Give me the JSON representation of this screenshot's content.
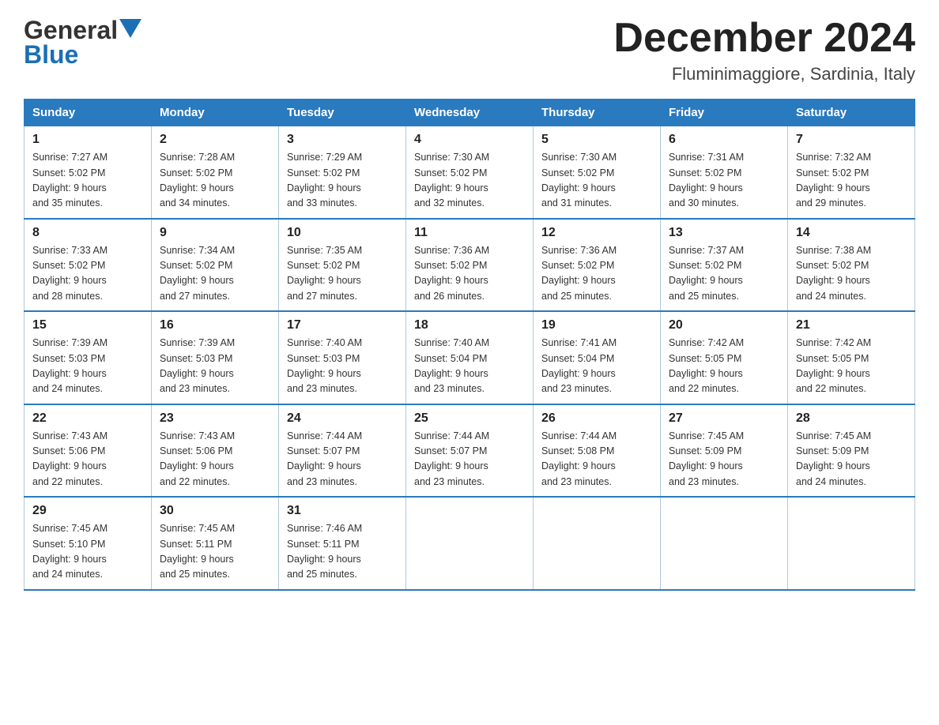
{
  "header": {
    "logo_part1": "General",
    "logo_part2": "Blue",
    "month_title": "December 2024",
    "location": "Fluminimaggiore, Sardinia, Italy"
  },
  "weekdays": [
    "Sunday",
    "Monday",
    "Tuesday",
    "Wednesday",
    "Thursday",
    "Friday",
    "Saturday"
  ],
  "weeks": [
    [
      {
        "day": "1",
        "sunrise": "7:27 AM",
        "sunset": "5:02 PM",
        "daylight": "9 hours and 35 minutes."
      },
      {
        "day": "2",
        "sunrise": "7:28 AM",
        "sunset": "5:02 PM",
        "daylight": "9 hours and 34 minutes."
      },
      {
        "day": "3",
        "sunrise": "7:29 AM",
        "sunset": "5:02 PM",
        "daylight": "9 hours and 33 minutes."
      },
      {
        "day": "4",
        "sunrise": "7:30 AM",
        "sunset": "5:02 PM",
        "daylight": "9 hours and 32 minutes."
      },
      {
        "day": "5",
        "sunrise": "7:30 AM",
        "sunset": "5:02 PM",
        "daylight": "9 hours and 31 minutes."
      },
      {
        "day": "6",
        "sunrise": "7:31 AM",
        "sunset": "5:02 PM",
        "daylight": "9 hours and 30 minutes."
      },
      {
        "day": "7",
        "sunrise": "7:32 AM",
        "sunset": "5:02 PM",
        "daylight": "9 hours and 29 minutes."
      }
    ],
    [
      {
        "day": "8",
        "sunrise": "7:33 AM",
        "sunset": "5:02 PM",
        "daylight": "9 hours and 28 minutes."
      },
      {
        "day": "9",
        "sunrise": "7:34 AM",
        "sunset": "5:02 PM",
        "daylight": "9 hours and 27 minutes."
      },
      {
        "day": "10",
        "sunrise": "7:35 AM",
        "sunset": "5:02 PM",
        "daylight": "9 hours and 27 minutes."
      },
      {
        "day": "11",
        "sunrise": "7:36 AM",
        "sunset": "5:02 PM",
        "daylight": "9 hours and 26 minutes."
      },
      {
        "day": "12",
        "sunrise": "7:36 AM",
        "sunset": "5:02 PM",
        "daylight": "9 hours and 25 minutes."
      },
      {
        "day": "13",
        "sunrise": "7:37 AM",
        "sunset": "5:02 PM",
        "daylight": "9 hours and 25 minutes."
      },
      {
        "day": "14",
        "sunrise": "7:38 AM",
        "sunset": "5:02 PM",
        "daylight": "9 hours and 24 minutes."
      }
    ],
    [
      {
        "day": "15",
        "sunrise": "7:39 AM",
        "sunset": "5:03 PM",
        "daylight": "9 hours and 24 minutes."
      },
      {
        "day": "16",
        "sunrise": "7:39 AM",
        "sunset": "5:03 PM",
        "daylight": "9 hours and 23 minutes."
      },
      {
        "day": "17",
        "sunrise": "7:40 AM",
        "sunset": "5:03 PM",
        "daylight": "9 hours and 23 minutes."
      },
      {
        "day": "18",
        "sunrise": "7:40 AM",
        "sunset": "5:04 PM",
        "daylight": "9 hours and 23 minutes."
      },
      {
        "day": "19",
        "sunrise": "7:41 AM",
        "sunset": "5:04 PM",
        "daylight": "9 hours and 23 minutes."
      },
      {
        "day": "20",
        "sunrise": "7:42 AM",
        "sunset": "5:05 PM",
        "daylight": "9 hours and 22 minutes."
      },
      {
        "day": "21",
        "sunrise": "7:42 AM",
        "sunset": "5:05 PM",
        "daylight": "9 hours and 22 minutes."
      }
    ],
    [
      {
        "day": "22",
        "sunrise": "7:43 AM",
        "sunset": "5:06 PM",
        "daylight": "9 hours and 22 minutes."
      },
      {
        "day": "23",
        "sunrise": "7:43 AM",
        "sunset": "5:06 PM",
        "daylight": "9 hours and 22 minutes."
      },
      {
        "day": "24",
        "sunrise": "7:44 AM",
        "sunset": "5:07 PM",
        "daylight": "9 hours and 23 minutes."
      },
      {
        "day": "25",
        "sunrise": "7:44 AM",
        "sunset": "5:07 PM",
        "daylight": "9 hours and 23 minutes."
      },
      {
        "day": "26",
        "sunrise": "7:44 AM",
        "sunset": "5:08 PM",
        "daylight": "9 hours and 23 minutes."
      },
      {
        "day": "27",
        "sunrise": "7:45 AM",
        "sunset": "5:09 PM",
        "daylight": "9 hours and 23 minutes."
      },
      {
        "day": "28",
        "sunrise": "7:45 AM",
        "sunset": "5:09 PM",
        "daylight": "9 hours and 24 minutes."
      }
    ],
    [
      {
        "day": "29",
        "sunrise": "7:45 AM",
        "sunset": "5:10 PM",
        "daylight": "9 hours and 24 minutes."
      },
      {
        "day": "30",
        "sunrise": "7:45 AM",
        "sunset": "5:11 PM",
        "daylight": "9 hours and 25 minutes."
      },
      {
        "day": "31",
        "sunrise": "7:46 AM",
        "sunset": "5:11 PM",
        "daylight": "9 hours and 25 minutes."
      },
      null,
      null,
      null,
      null
    ]
  ],
  "labels": {
    "sunrise": "Sunrise:",
    "sunset": "Sunset:",
    "daylight": "Daylight:"
  }
}
